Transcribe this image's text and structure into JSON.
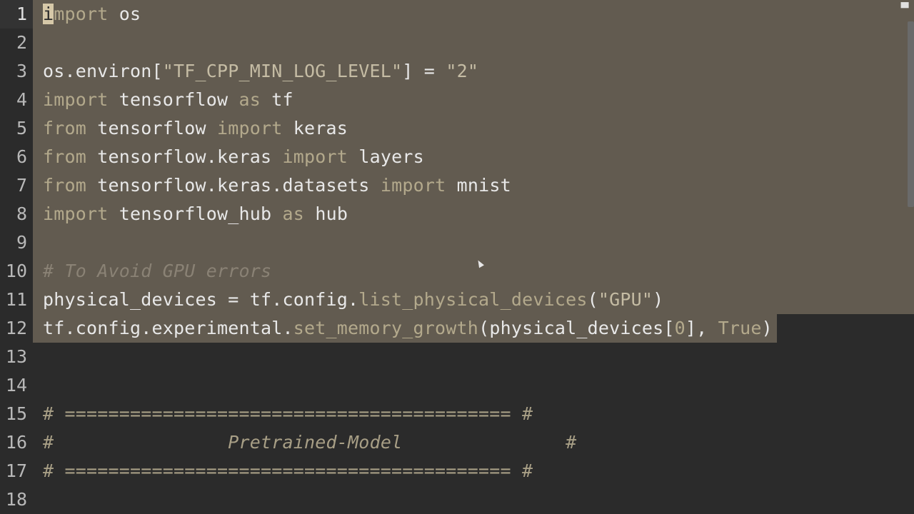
{
  "toolbar": {
    "close_glyph": "▀"
  },
  "lines": [
    {
      "n": "1",
      "parts": [
        [
          "cursor",
          "i"
        ],
        [
          "kw",
          "mport"
        ],
        [
          "plain",
          " os"
        ]
      ]
    },
    {
      "n": "2",
      "parts": []
    },
    {
      "n": "3",
      "parts": [
        [
          "plain",
          "os.environ["
        ],
        [
          "str",
          "\"TF_CPP_MIN_LOG_LEVEL\""
        ],
        [
          "plain",
          "] = "
        ],
        [
          "str",
          "\"2\""
        ]
      ]
    },
    {
      "n": "4",
      "parts": [
        [
          "kw",
          "import"
        ],
        [
          "plain",
          " tensorflow "
        ],
        [
          "kw",
          "as"
        ],
        [
          "plain",
          " tf"
        ]
      ]
    },
    {
      "n": "5",
      "parts": [
        [
          "kw",
          "from"
        ],
        [
          "plain",
          " tensorflow "
        ],
        [
          "kw",
          "import"
        ],
        [
          "plain",
          " keras"
        ]
      ]
    },
    {
      "n": "6",
      "parts": [
        [
          "kw",
          "from"
        ],
        [
          "plain",
          " tensorflow.keras "
        ],
        [
          "kw",
          "import"
        ],
        [
          "plain",
          " layers"
        ]
      ]
    },
    {
      "n": "7",
      "parts": [
        [
          "kw",
          "from"
        ],
        [
          "plain",
          " tensorflow.keras.datasets "
        ],
        [
          "kw",
          "import"
        ],
        [
          "plain",
          " mnist"
        ]
      ]
    },
    {
      "n": "8",
      "parts": [
        [
          "kw",
          "import"
        ],
        [
          "plain",
          " tensorflow_hub "
        ],
        [
          "kw",
          "as"
        ],
        [
          "plain",
          " hub"
        ]
      ]
    },
    {
      "n": "9",
      "parts": []
    },
    {
      "n": "10",
      "parts": [
        [
          "cm",
          "# To Avoid GPU errors"
        ]
      ]
    },
    {
      "n": "11",
      "parts": [
        [
          "plain",
          "physical_devices = tf.config."
        ],
        [
          "kw",
          "list_physical_devices"
        ],
        [
          "plain",
          "("
        ],
        [
          "str",
          "\"GPU\""
        ],
        [
          "plain",
          ")"
        ]
      ]
    },
    {
      "n": "12",
      "parts": [
        [
          "plain",
          "tf.config.experimental."
        ],
        [
          "kw",
          "set_memory_growth"
        ],
        [
          "plain",
          "(physical_devices["
        ],
        [
          "num",
          "0"
        ],
        [
          "plain",
          "], "
        ],
        [
          "kw",
          "True"
        ],
        [
          "plain",
          ")"
        ]
      ]
    },
    {
      "n": "13",
      "parts": []
    },
    {
      "n": "14",
      "parts": []
    },
    {
      "n": "15",
      "parts": [
        [
          "hdr",
          "# ========================================= #"
        ]
      ]
    },
    {
      "n": "16",
      "parts": [
        [
          "hdr",
          "#"
        ],
        [
          "plain",
          "                "
        ],
        [
          "hdr-title",
          "Pretrained-Model"
        ],
        [
          "plain",
          "               "
        ],
        [
          "hdr",
          "#"
        ]
      ]
    },
    {
      "n": "17",
      "parts": [
        [
          "hdr",
          "# ========================================= #"
        ]
      ]
    },
    {
      "n": "18",
      "parts": []
    }
  ],
  "colors": {
    "background": "#2b2b2b",
    "selection": "#625b50",
    "keyword": "#b3a98c",
    "text": "#e8e8e8"
  }
}
